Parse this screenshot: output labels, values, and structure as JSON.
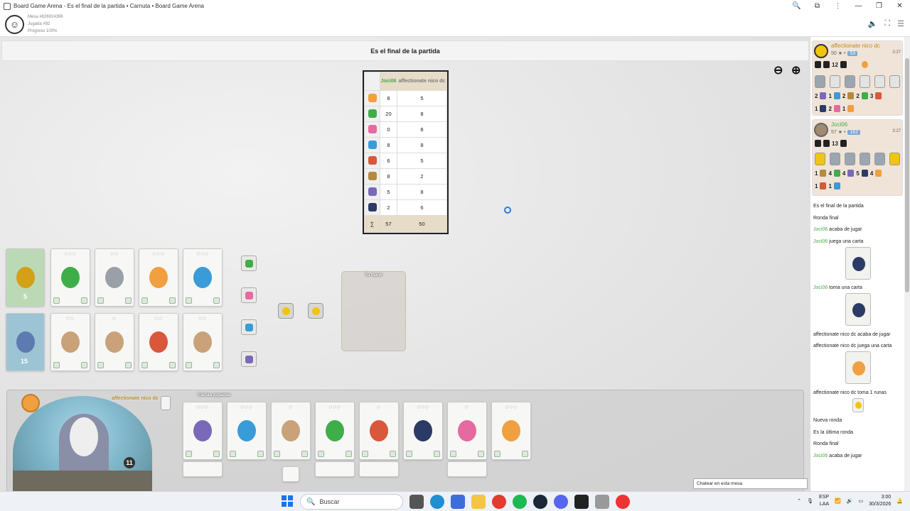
{
  "browser": {
    "title": "Board Game Arena - Es el final de la partida • Carnuta • Board Game Arena",
    "buttons": [
      "🔍",
      "⧉",
      "⋮",
      "—",
      "❐",
      "✕"
    ]
  },
  "bga_header": {
    "logo": "☺",
    "table": "Mesa #826924396",
    "move": "Jugada #92",
    "progress": "Progreso 100%"
  },
  "status": {
    "text": "Es el final de la partida"
  },
  "zoom": {
    "out": "⊖",
    "in": "⊕"
  },
  "score_table": {
    "players": [
      "Joci06",
      "affectionate nico dc"
    ],
    "rows": [
      {
        "icon": "orange-sponge-icon",
        "color": "#f0a040",
        "a": "8",
        "b": "5"
      },
      {
        "icon": "clover-icon",
        "color": "#3fae49",
        "a": "20",
        "b": "8"
      },
      {
        "icon": "flower-icon",
        "color": "#e46aa0",
        "a": "0",
        "b": "8"
      },
      {
        "icon": "egg-icon",
        "color": "#3a9bd9",
        "a": "8",
        "b": "8"
      },
      {
        "icon": "mushroom-icon",
        "color": "#d9573b",
        "a": "6",
        "b": "5"
      },
      {
        "icon": "feather-icon",
        "color": "#b48a3c",
        "a": "8",
        "b": "2"
      },
      {
        "icon": "grape-icon",
        "color": "#7a69b8",
        "a": "5",
        "b": "8"
      },
      {
        "icon": "butterfly-icon",
        "color": "#2c3a66",
        "a": "2",
        "b": "6"
      }
    ],
    "sum_symbol": "∑",
    "total_a": "57",
    "total_b": "50"
  },
  "market_top": {
    "card0_count": "5",
    "cards": [
      {
        "cost": "◌◌◌",
        "color": "#3fae49"
      },
      {
        "cost": "◌◌",
        "color": "#9aa0a8"
      },
      {
        "cost": "◌◌◌",
        "color": "#f0a040"
      },
      {
        "cost": "◌◌◌",
        "color": "#3a9bd9"
      }
    ]
  },
  "market_bottom": {
    "card0_count": "15",
    "cards": [
      {
        "cost": "◌◌",
        "color": "#c9a27a"
      },
      {
        "cost": "◌",
        "color": "#c9a27a"
      },
      {
        "cost": "◌◌",
        "color": "#d9573b"
      },
      {
        "cost": "◌◌",
        "color": "#c9a27a"
      }
    ]
  },
  "tokens": [
    {
      "color": "#3fae49"
    },
    {
      "color": "#e46aa0"
    },
    {
      "color": "#3a9bd9"
    },
    {
      "color": "#7a69b8"
    }
  ],
  "hand": {
    "label": "Tu mano"
  },
  "player_board": {
    "name": "affectionate nico dc",
    "played_label": "Cartas jugadas",
    "rune_count": "11",
    "played_cards": [
      {
        "cost": "◌◌◌",
        "color": "#7a69b8"
      },
      {
        "cost": "◌◌◌",
        "color": "#3a9bd9"
      },
      {
        "cost": "◌",
        "color": "#c9a27a"
      },
      {
        "cost": "◌◌◌",
        "color": "#3fae49"
      },
      {
        "cost": "◌",
        "color": "#d9573b"
      },
      {
        "cost": "◌◌◌",
        "color": "#2c3a66"
      },
      {
        "cost": "◌",
        "color": "#e46aa0"
      },
      {
        "cost": "◌◌◌",
        "color": "#f0a040"
      }
    ]
  },
  "side_panel": {
    "p1": {
      "name": "affectionate nico dc",
      "stats": "50 ★ •",
      "badge": "53",
      "time": "3:27",
      "cards": "12",
      "row1": "2",
      "row1b": "1",
      "row1c": "2",
      "row1d": "2",
      "row1e": "3",
      "row2": "1",
      "row2b": "2",
      "row2c": "1"
    },
    "p2": {
      "name": "Joci06",
      "stats": "57 ★ •",
      "badge": "162",
      "time": "3:27",
      "cards": "13",
      "row1": "1",
      "row1b": "4",
      "row1c": "4",
      "row1d": "5",
      "row1e": "4",
      "row2": "1",
      "row2b": "1"
    }
  },
  "log": [
    {
      "pre": "",
      "who": "",
      "text": "Es el final de la partida"
    },
    {
      "pre": "",
      "who": "",
      "text": "Ronda final"
    },
    {
      "pre": "",
      "who": "Joci06",
      "text": " acaba de jugar"
    },
    {
      "pre": "",
      "who": "Joci06",
      "text": " juega una carta"
    },
    {
      "pre": "",
      "who": "Joci06",
      "text": " toma una carta"
    },
    {
      "pre": "affectionate nico dc",
      "who": "",
      "text": " acaba de jugar"
    },
    {
      "pre": "affectionate nico dc",
      "who": "",
      "text": " juega una carta"
    },
    {
      "pre": "affectionate nico dc",
      "who": "",
      "text": " toma 1 runas"
    },
    {
      "pre": "",
      "who": "",
      "text": "Nueva ronda"
    },
    {
      "pre": "",
      "who": "",
      "text": "Es la última ronda"
    },
    {
      "pre": "",
      "who": "",
      "text": "Ronda final"
    },
    {
      "pre": "",
      "who": "Joci06",
      "text": " acaba de jugar"
    }
  ],
  "chat": {
    "placeholder": "Chatear en esta mesa"
  },
  "taskbar": {
    "search": "Buscar",
    "lang": "ESP",
    "lang2": "LAA",
    "time": "3:00",
    "date": "30/3/2026"
  }
}
